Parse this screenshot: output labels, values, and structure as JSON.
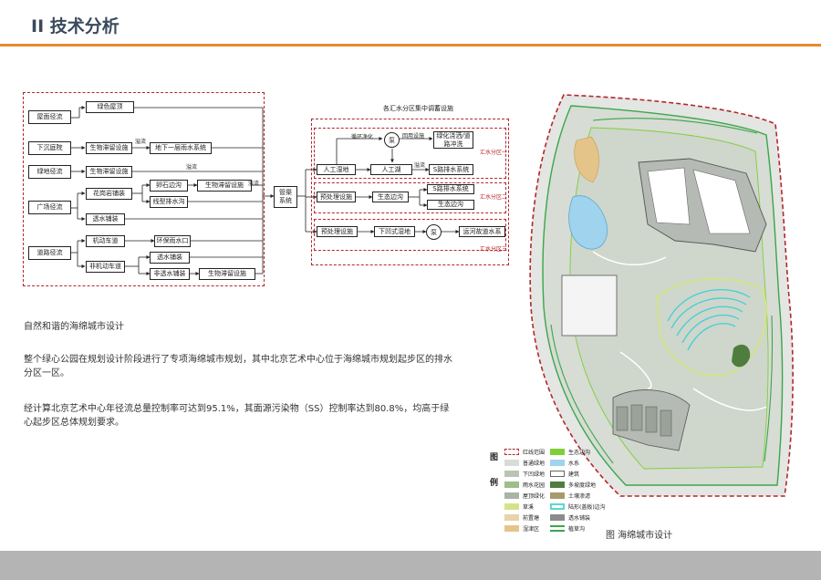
{
  "header": {
    "title": "II 技术分析"
  },
  "flow": {
    "sources": [
      "屋面径流",
      "下沉庭院",
      "绿地径流",
      "广场径流",
      "道路径流"
    ],
    "mid": {
      "green_roof": "绿色屋顶",
      "bio_retention_1": "生物滞留设施",
      "underground_rain": "地下一层雨水系统",
      "bio_retention_2": "生物滞留设施",
      "flower_paving": "花岗岩铺装",
      "pebble_ditch": "卵石边沟",
      "bio_retention_3": "生物滞留设施",
      "linear_drain": "线型排水沟",
      "permeable_paving_1": "透水铺装",
      "motor_road": "机动车道",
      "eco_inlet": "环保雨水口",
      "non_motor_road": "非机动车道",
      "permeable_paving_2": "透水铺装",
      "non_permeable_paving": "非透水铺装",
      "bio_retention_4": "生物滞留设施",
      "pipe_system": "管渠系统"
    },
    "overflow_labels": [
      "溢流",
      "溢流",
      "溢流"
    ],
    "right_title": "各汇水分区集中调蓄设施",
    "zones": [
      "汇水分区一",
      "汇水分区二",
      "汇水分区三"
    ],
    "right": {
      "circulation": "循环净化",
      "pump": "泵",
      "reuse": "回用设施",
      "constructed_wetland": "人工湿地",
      "artificial_lake": "人工湖",
      "green_irrigation": "绿化浇洒/道路冲洗",
      "overflow_a": "溢流",
      "s_drain_1": "S路排水系统",
      "pretreat_1": "预处理设施",
      "eco_ditch": "生态边沟",
      "s_drain_2": "S路排水系统",
      "eco_ditch_2": "生态边沟",
      "pretreat_2": "预处理设施",
      "sunken_wetland": "下凹式湿地",
      "pump_2": "泵",
      "canal": "运河故道水系"
    }
  },
  "text": {
    "subtitle": "自然和谐的海绵城市设计",
    "para1": "整个绿心公园在规划设计阶段进行了专项海绵城市规划，其中北京艺术中心位于海绵城市规划起步区的排水分区一区。",
    "para2": "经计算北京艺术中心年径流总量控制率可达到95.1%，其面源污染物（SS）控制率达到80.8%，均高于绿心起步区总体规划要求。"
  },
  "legend": {
    "head": "图例",
    "items": [
      {
        "label": "红线范围",
        "color": "#b5262c"
      },
      {
        "label": "生态边沟",
        "color": "#7fcf3a"
      },
      {
        "label": "普通绿地",
        "color": "#d8dcd6"
      },
      {
        "label": "水系",
        "color": "#9fd3ee"
      },
      {
        "label": "下凹绿地",
        "color": "#b8c5b4"
      },
      {
        "label": "建筑",
        "color": "#ffffff"
      },
      {
        "label": "雨水花园",
        "color": "#9dbe8a"
      },
      {
        "label": "多坡度绿地",
        "color": "#4f7d3d"
      },
      {
        "label": "屋顶绿化",
        "color": "#a8b4a8"
      },
      {
        "label": "土壤渗滤",
        "color": "#a89a6a"
      },
      {
        "label": "草溪",
        "color": "#d4e38a"
      },
      {
        "label": "陆形(盖板)边沟",
        "color": "#5fd6d0"
      },
      {
        "label": "前置塘",
        "color": "#e7d4a8"
      },
      {
        "label": "透水铺装",
        "color": "#8b8b8b"
      },
      {
        "label": "湿津区",
        "color": "#e5c48a"
      },
      {
        "label": "植草沟",
        "color": "#3aa64a"
      }
    ]
  },
  "caption": "图 海绵城市设计"
}
